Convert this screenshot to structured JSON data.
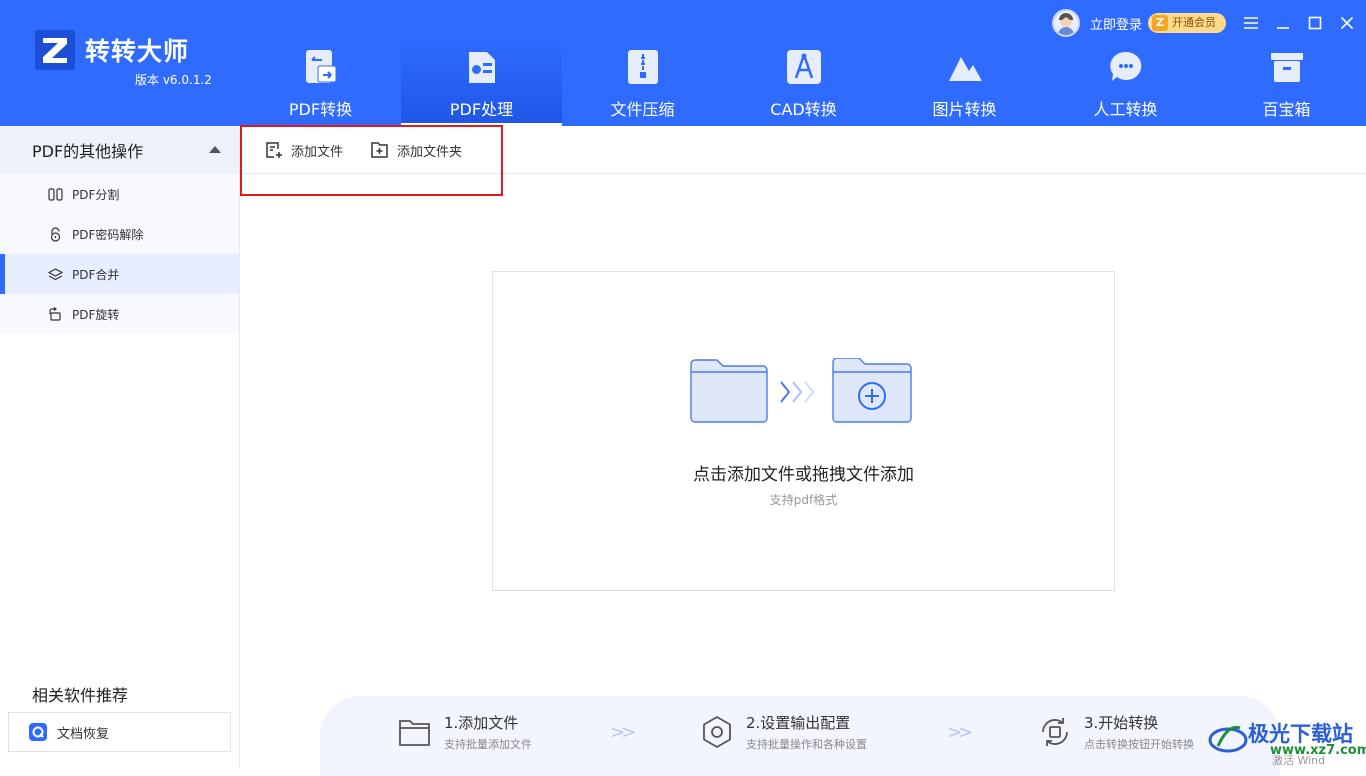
{
  "app": {
    "title": "转转大师",
    "version": "版本 v6.0.1.2",
    "brand_color": "#2f6bff"
  },
  "user": {
    "login_text": "立即登录",
    "vip_text": "开通会员",
    "vip_badge_letter": "Z"
  },
  "nav": {
    "items": [
      {
        "label": "PDF转换",
        "icon": "pdf-convert-icon"
      },
      {
        "label": "PDF处理",
        "icon": "pdf-process-icon",
        "active": true
      },
      {
        "label": "文件压缩",
        "icon": "zip-icon"
      },
      {
        "label": "CAD转换",
        "icon": "cad-compass-icon"
      },
      {
        "label": "图片转换",
        "icon": "mountain-image-icon"
      },
      {
        "label": "人工转换",
        "icon": "chat-bubble-icon"
      },
      {
        "label": "百宝箱",
        "icon": "toolbox-icon"
      }
    ]
  },
  "sidebar": {
    "group_title": "PDF的其他操作",
    "items": [
      {
        "label": "PDF分割",
        "icon": "split-icon"
      },
      {
        "label": "PDF密码解除",
        "icon": "unlock-icon"
      },
      {
        "label": "PDF合并",
        "icon": "layers-icon",
        "active": true
      },
      {
        "label": "PDF旋转",
        "icon": "rotate-icon"
      }
    ],
    "related_title": "相关软件推荐",
    "related_item": "文档恢复"
  },
  "toolbar": {
    "add_file": "添加文件",
    "add_folder": "添加文件夹"
  },
  "dropzone": {
    "main_text": "点击添加文件或拖拽文件添加",
    "sub_text": "支持pdf格式"
  },
  "steps": [
    {
      "title": "1.添加文件",
      "desc": "支持批量添加文件",
      "icon": "folder-icon"
    },
    {
      "title": "2.设置输出配置",
      "desc": "支持批量操作和各种设置",
      "icon": "settings-hex-icon"
    },
    {
      "title": "3.开始转换",
      "desc": "点击转换按钮开始转换",
      "icon": "convert-icon"
    }
  ],
  "step_arrow": ">>",
  "watermark": {
    "text": "极光下载站",
    "url": "www.xz7.com",
    "faint": "激活 Wind"
  }
}
